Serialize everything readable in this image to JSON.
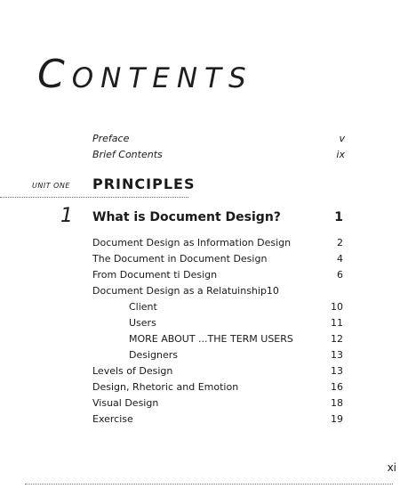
{
  "page": {
    "title": "Contents",
    "folio": "xi"
  },
  "front_matter": [
    {
      "label": "Preface",
      "page": "v"
    },
    {
      "label": "Brief Contents",
      "page": "ix"
    }
  ],
  "unit": {
    "label": "UNIT ONE",
    "title": "PRINCIPLES"
  },
  "chapter": {
    "number": "1",
    "title": "What is Document Design?",
    "page": "1"
  },
  "entries": [
    {
      "label": "Document Design as Information Design",
      "page": "2",
      "level": 1
    },
    {
      "label": "The Document in Document Design",
      "page": "4",
      "level": 1
    },
    {
      "label": "From Document ti Design",
      "page": "6",
      "level": 1
    },
    {
      "label": "Document Design as a Relatuinship10",
      "page": "",
      "level": 1
    },
    {
      "label": "Client",
      "page": "10",
      "level": 2
    },
    {
      "label": "Users",
      "page": "11",
      "level": 2
    },
    {
      "label": "MORE ABOUT ...THE TERM USERS",
      "page": "12",
      "level": 2
    },
    {
      "label": "Designers",
      "page": "13",
      "level": 2
    },
    {
      "label": "Levels of Design",
      "page": "13",
      "level": 1
    },
    {
      "label": "Design, Rhetoric and Emotion",
      "page": "16",
      "level": 1
    },
    {
      "label": "Visual Design",
      "page": "18",
      "level": 1
    },
    {
      "label": "Exercise",
      "page": "19",
      "level": 1
    }
  ]
}
